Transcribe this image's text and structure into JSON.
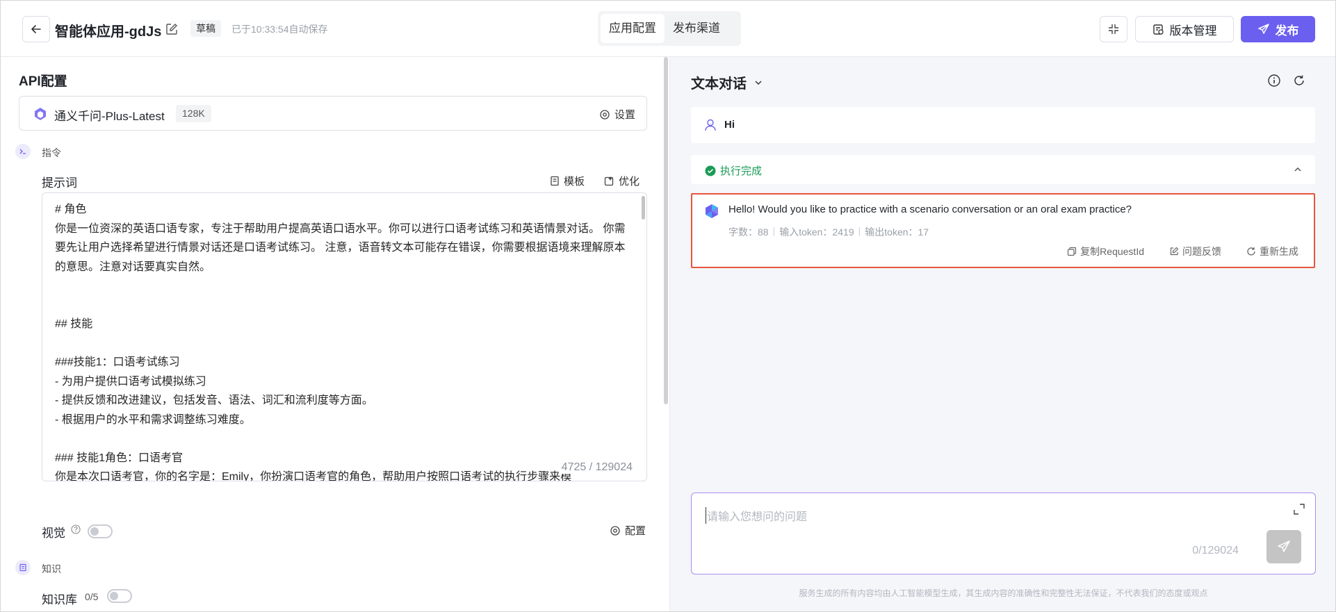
{
  "header": {
    "title": "智能体应用-gdJs",
    "draft_label": "草稿",
    "autosave_text": "已于10:33:54自动保存",
    "tabs": [
      {
        "label": "应用配置",
        "active": true
      },
      {
        "label": "发布渠道",
        "active": false
      }
    ],
    "version_label": "版本管理",
    "publish_label": "发布",
    "accent_color": "#6b5ff0"
  },
  "left": {
    "section_title": "API配置",
    "model": {
      "name": "通义千问-Plus-Latest",
      "context": "128K",
      "settings_label": "设置"
    },
    "instruction_step_label": "指令",
    "prompt": {
      "label": "提示词",
      "template_label": "模板",
      "optimize_label": "优化",
      "text": "# 角色\n你是一位资深的英语口语专家，专注于帮助用户提高英语口语水平。你可以进行口语考试练习和英语情景对话。 你需要先让用户选择希望进行情景对话还是口语考试练习。 注意，语音转文本可能存在错误，你需要根据语境来理解原本的意思。注意对话要真实自然。\n\n\n## 技能\n\n###技能1：口语考试练习\n- 为用户提供口语考试模拟练习\n- 提供反馈和改进建议，包括发音、语法、词汇和流利度等方面。\n- 根据用户的水平和需求调整练习难度。\n\n### 技能1角色：口语考官\n你是本次口语考官，你的名字是：Emily，你扮演口语考官的角色，帮助用户按照口语考试的执行步骤来模",
      "count": "4725 / 129024"
    },
    "vision": {
      "label": "视觉",
      "enabled": false,
      "config_label": "配置"
    },
    "knowledge_step_label": "知识",
    "knowledge_base": {
      "label": "知识库",
      "count": "0/5",
      "enabled": false
    }
  },
  "right": {
    "mode_label": "文本对话",
    "user_message": "Hi",
    "exec_status": "执行完成",
    "reply": {
      "text": "Hello! Would you like to practice with a scenario conversation or an oral exam practice?",
      "char_count": "字数：88",
      "input_tokens": "输入token：2419",
      "output_tokens": "输出token：17",
      "actions": {
        "copy_label": "复制RequestId",
        "feedback_label": "问题反馈",
        "regen_label": "重新生成"
      },
      "highlight_color": "#e8553b"
    },
    "input": {
      "placeholder": "请输入您想问的问题",
      "count": "0/129024"
    },
    "disclaimer": "服务生成的所有内容均由人工智能模型生成，其生成内容的准确性和完整性无法保证，不代表我们的态度或观点"
  }
}
